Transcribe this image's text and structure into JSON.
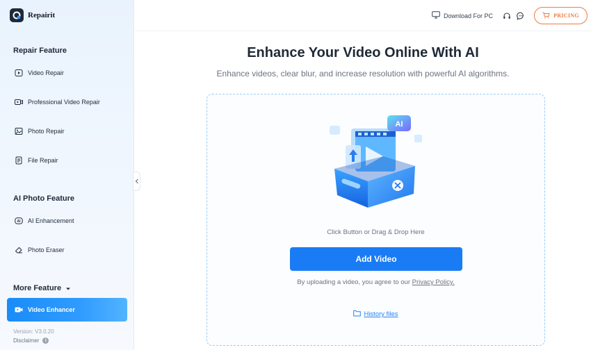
{
  "app": {
    "name": "Repairit"
  },
  "sidebar": {
    "repair_section": "Repair Feature",
    "repair_items": [
      {
        "label": "Video Repair",
        "icon": "play-icon"
      },
      {
        "label": "Professional Video Repair",
        "icon": "video-camera-icon"
      },
      {
        "label": "Photo Repair",
        "icon": "image-icon"
      },
      {
        "label": "File Repair",
        "icon": "file-icon"
      }
    ],
    "ai_section": "AI Photo Feature",
    "ai_items": [
      {
        "label": "AI Enhancement",
        "icon": "ai-badge-icon"
      },
      {
        "label": "Photo Eraser",
        "icon": "eraser-icon"
      }
    ],
    "more_label": "More Feature",
    "active_item": {
      "label": "Video Enhancer",
      "icon": "video-camera-icon"
    },
    "version": "Version: V3.0.20",
    "disclaimer": "Disclaimer"
  },
  "topbar": {
    "download_label": "Download For PC",
    "pricing_label": "PRICING"
  },
  "main": {
    "title": "Enhance Your Video Online With AI",
    "subtitle": "Enhance videos, clear blur, and increase resolution with powerful AI algorithms.",
    "drop_hint": "Click Button or Drag & Drop Here",
    "add_button": "Add Video",
    "agree_prefix": "By uploading a video, you agree to our",
    "privacy_link": "Privacy Policy.",
    "history_label": "History files",
    "illustration_badge": "AI"
  },
  "colors": {
    "accent": "#1a7cf5",
    "pricing": "#f07b3f",
    "link": "#2684ef"
  }
}
